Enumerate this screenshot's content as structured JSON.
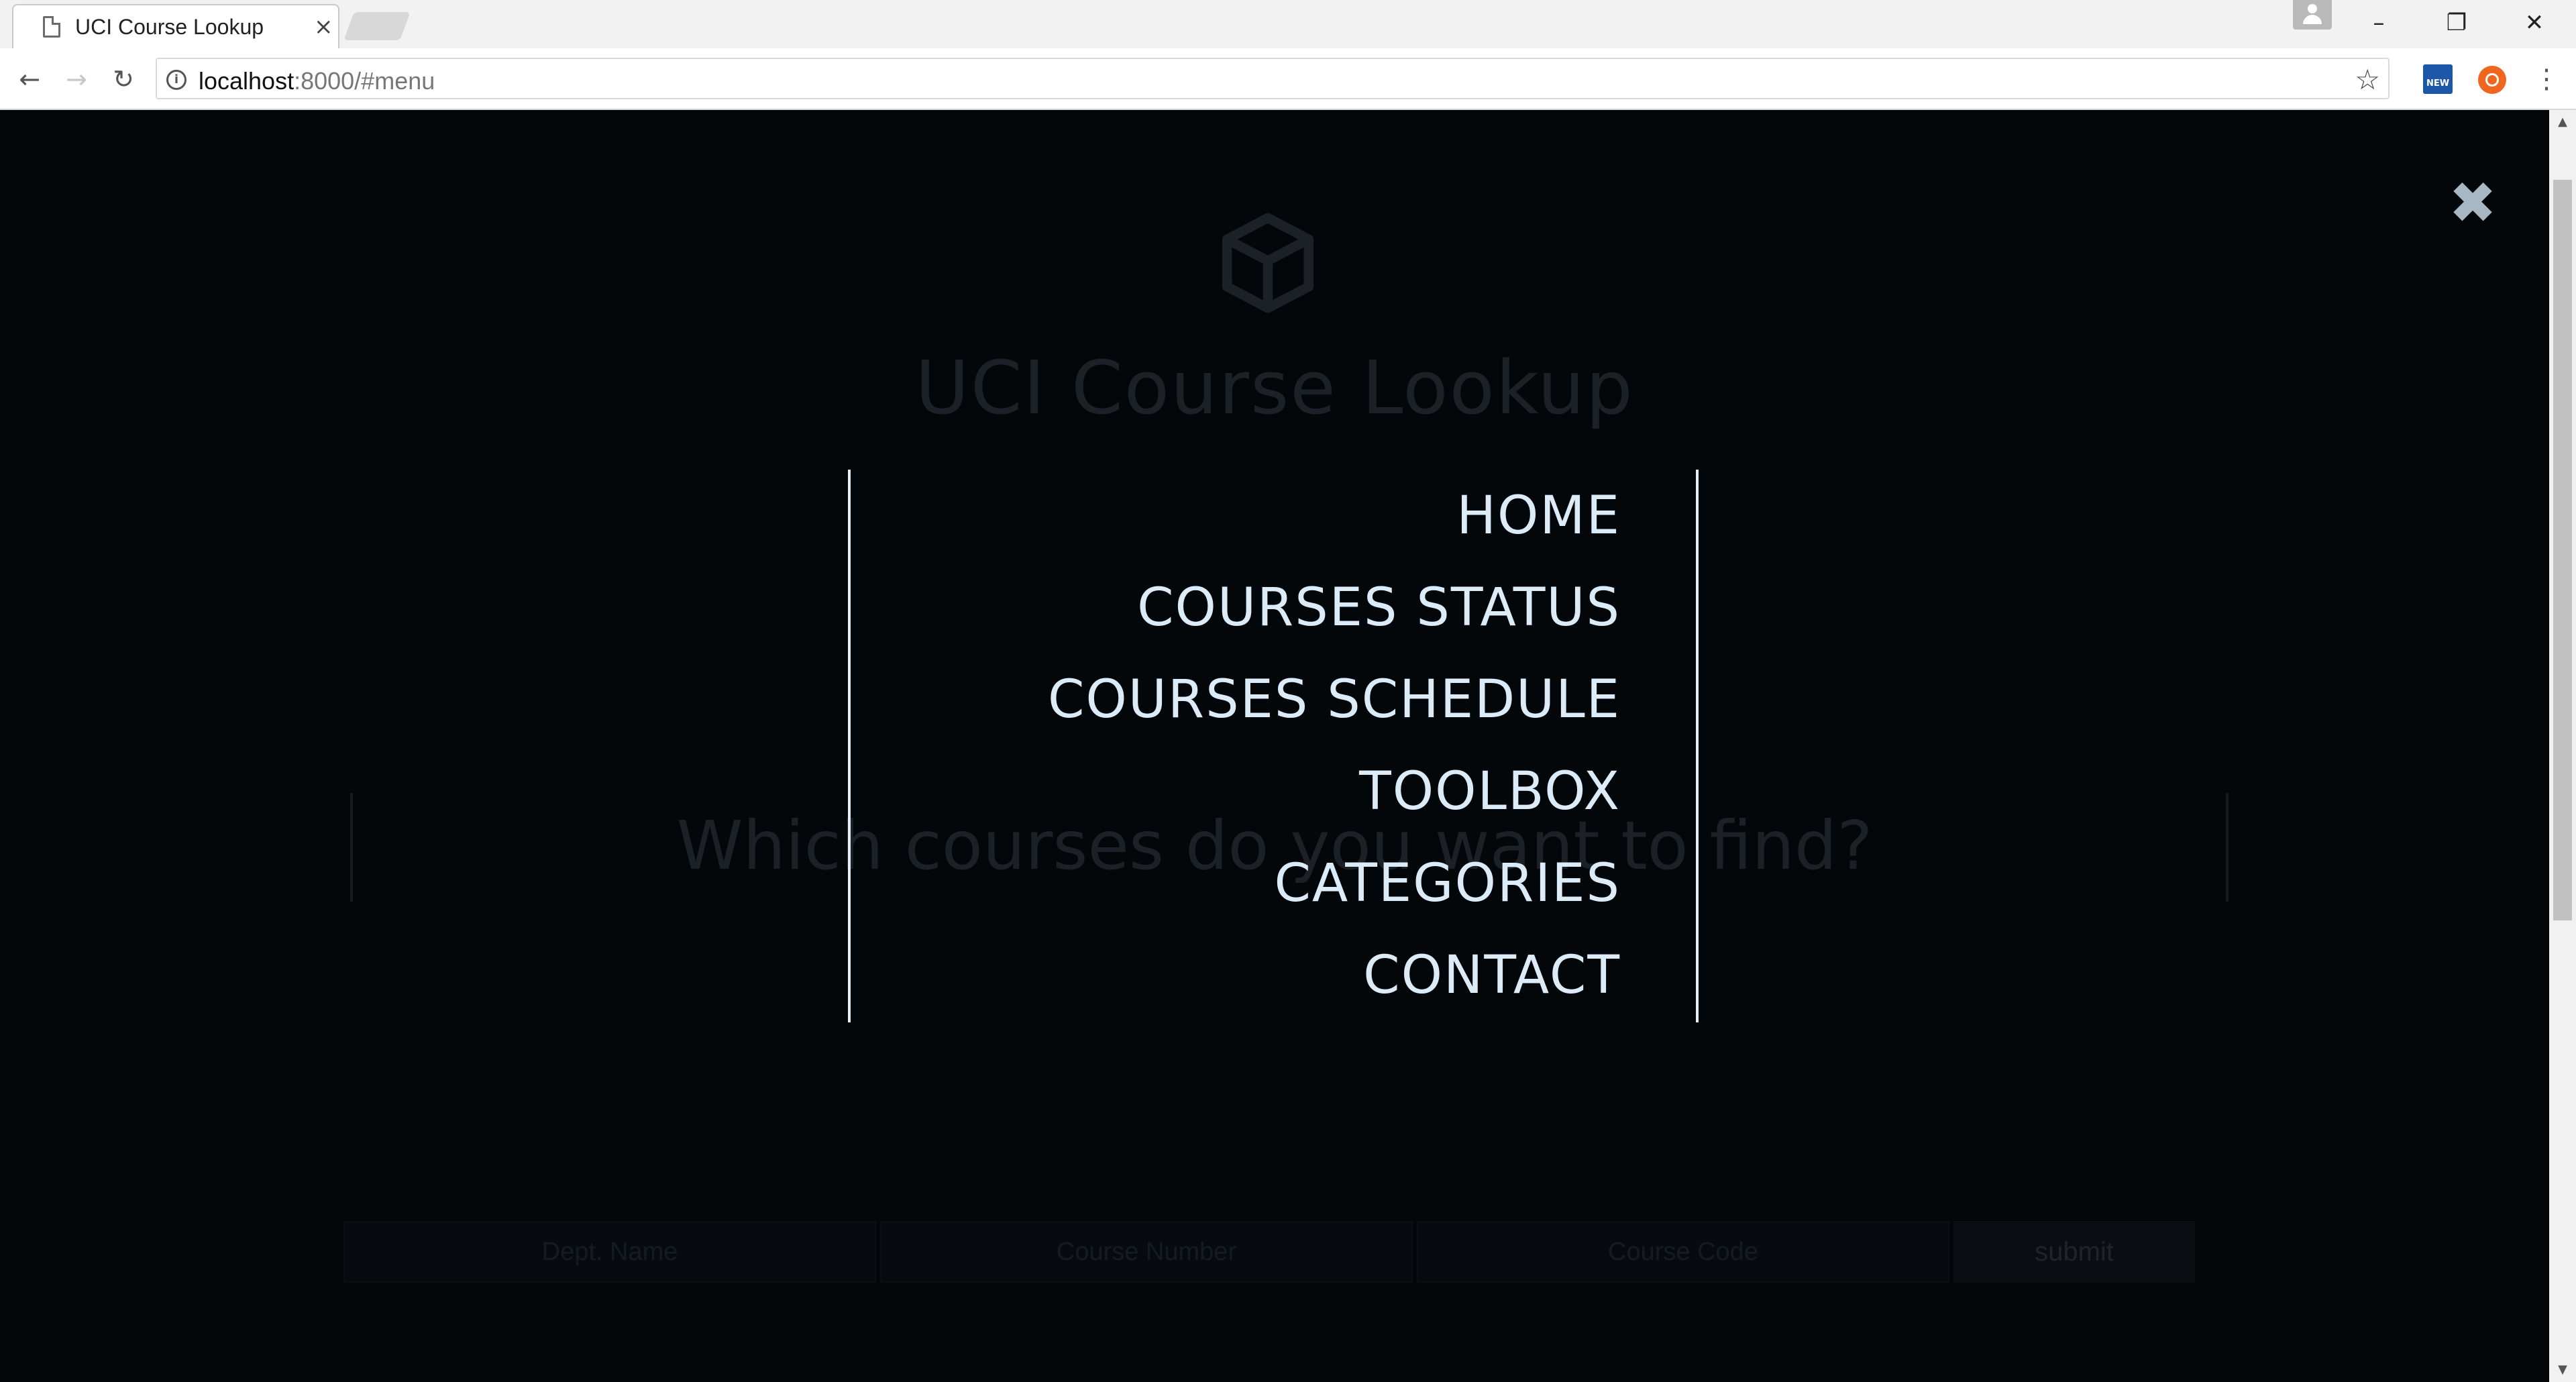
{
  "browser": {
    "tab_title": "UCI Course Lookup",
    "tab_close": "×",
    "url_host": "localhost",
    "url_rest": ":8000/#menu",
    "info_glyph": "i",
    "star_glyph": "☆",
    "ext_label": "NEW",
    "kebab": "⋮",
    "back": "←",
    "forward": "→",
    "reload": "↻",
    "minimize": "–",
    "restore": "❐",
    "close": "✕"
  },
  "page": {
    "title": "UCI Course Lookup",
    "search_question": "Which courses do you want to find?",
    "form": {
      "dept_placeholder": "Dept. Name",
      "number_placeholder": "Course Number",
      "code_placeholder": "Course Code",
      "submit_label": "submit"
    }
  },
  "menu": {
    "close_glyph": "✖",
    "items": [
      {
        "label": "HOME"
      },
      {
        "label": "COURSES STATUS"
      },
      {
        "label": "COURSES SCHEDULE"
      },
      {
        "label": "TOOLBOX"
      },
      {
        "label": "CATEGORIES"
      },
      {
        "label": "CONTACT"
      }
    ]
  },
  "colors": {
    "background": "#03070a",
    "menu_text": "#dcebf8",
    "divider": "#e6eef6",
    "close_icon": "#a7b7c4"
  }
}
